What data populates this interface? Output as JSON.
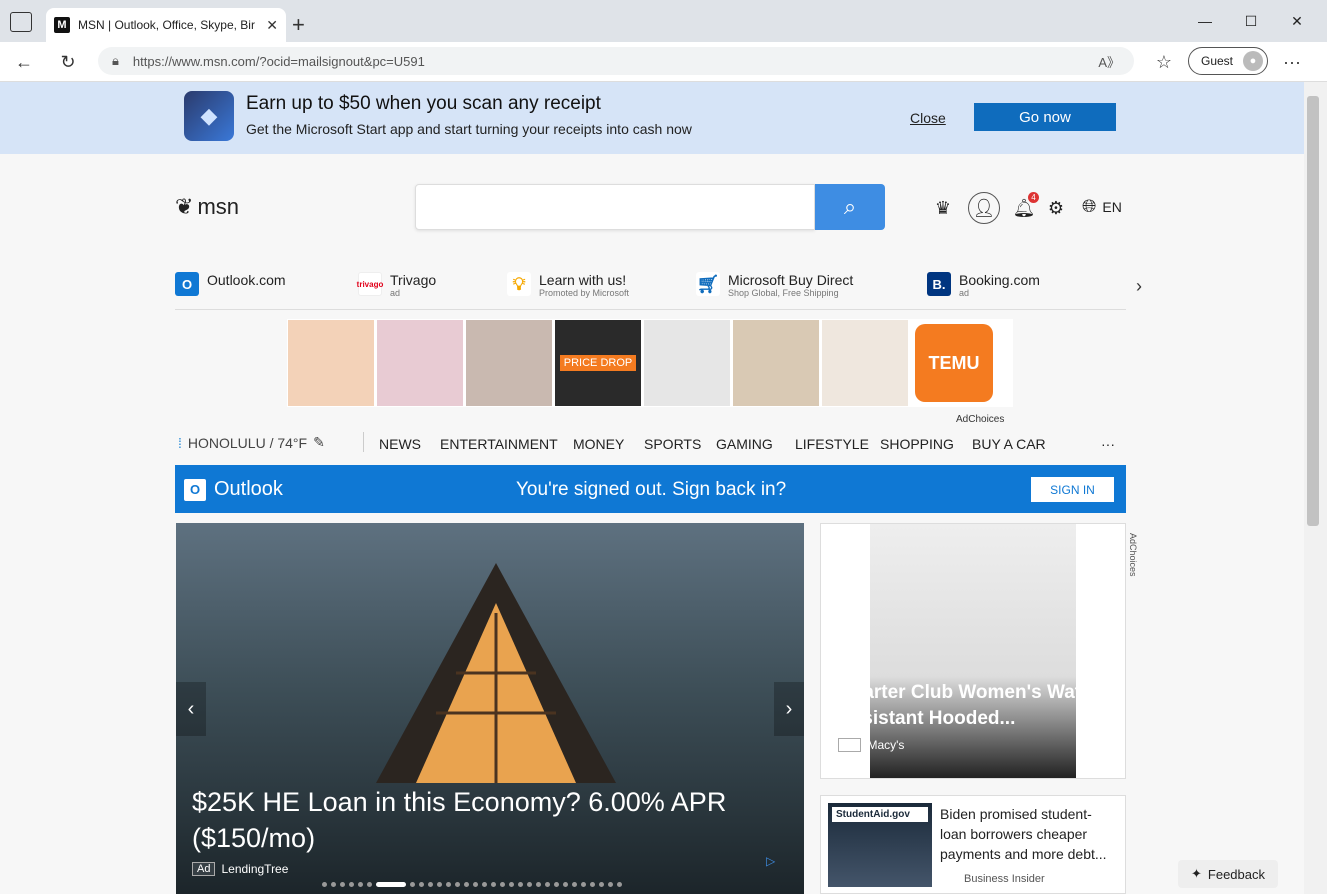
{
  "browser": {
    "tab_title": "MSN | Outlook, Office, Skype, Bir",
    "url": "https://www.msn.com/?ocid=mailsignout&pc=U591",
    "guest_label": "Guest"
  },
  "banner": {
    "title": "Earn up to $50 when you scan any receipt",
    "subtitle": "Get the Microsoft Start app and start turning your receipts into cash now",
    "close_label": "Close",
    "go_label": "Go now"
  },
  "header": {
    "logo_text": "msn",
    "lang": "EN",
    "notifications_count": "4"
  },
  "quicklinks": [
    {
      "label": "Outlook.com",
      "sub": ""
    },
    {
      "label": "Trivago",
      "sub": "ad"
    },
    {
      "label": "Learn with us!",
      "sub": "Promoted by Microsoft"
    },
    {
      "label": "Microsoft Buy Direct",
      "sub": "Shop Global, Free Shipping"
    },
    {
      "label": "Booking.com",
      "sub": "ad"
    }
  ],
  "ad_strip": {
    "badge": "PRICE DROP",
    "brand": "TEMU",
    "adchoices": "AdChoices"
  },
  "nav": {
    "weather": "HONOLULU / 74°F",
    "items": [
      "NEWS",
      "ENTERTAINMENT",
      "MONEY",
      "SPORTS",
      "GAMING",
      "LIFESTYLE",
      "SHOPPING",
      "BUY A CAR"
    ],
    "more": "···"
  },
  "outlook_bar": {
    "brand": "Outlook",
    "message": "You're signed out. Sign back in?",
    "button": "SIGN IN"
  },
  "hero": {
    "title": "$25K HE Loan in this Economy? 6.00% APR ($150/mo)",
    "ad_badge": "Ad",
    "source": "LendingTree"
  },
  "card1": {
    "title": "Charter Club Women's Water-Resistant Hooded...",
    "ad_badge": "Ad",
    "source": "Macy's"
  },
  "card2": {
    "image_label": "StudentAid.gov",
    "title": "Biden promised student-loan borrowers cheaper payments and more debt...",
    "source": "Business Insider"
  },
  "side_adchoices": "AdChoices",
  "feedback": "Feedback"
}
